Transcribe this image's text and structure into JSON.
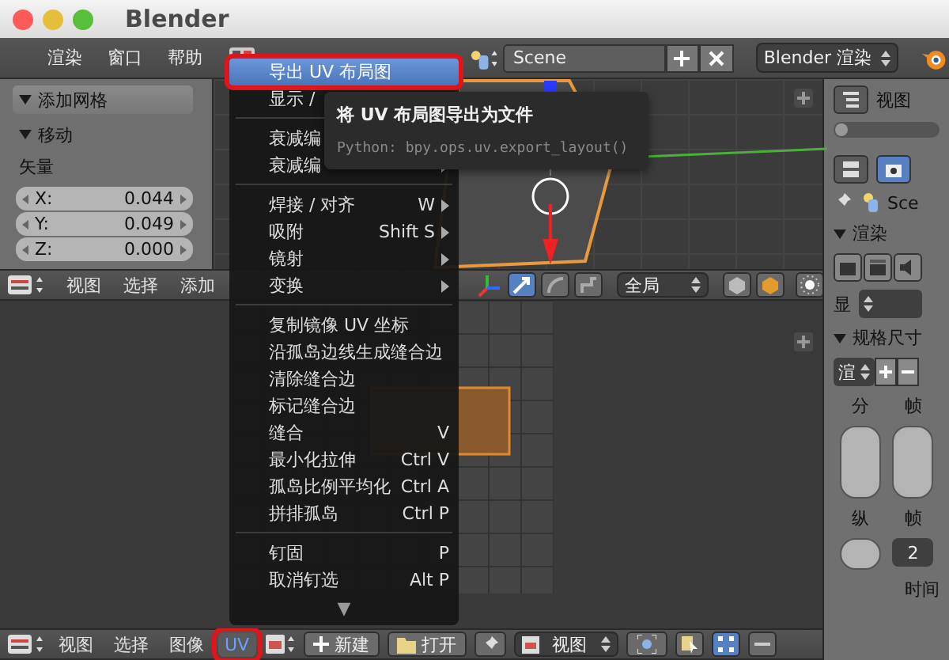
{
  "window": {
    "title": "Blender"
  },
  "top_header": {
    "menus": [
      "渲染",
      "窗口",
      "帮助"
    ],
    "scene": "Scene",
    "engine": "Blender 渲染"
  },
  "tool_shelf": {
    "panel_title": "添加网格",
    "operator": "移动",
    "vector_label": "矢量",
    "fields": [
      {
        "label": "X:",
        "value": "0.044"
      },
      {
        "label": "Y:",
        "value": "0.049"
      },
      {
        "label": "Z:",
        "value": "0.000"
      }
    ]
  },
  "viewport_header": {
    "menus": [
      "视图",
      "选择",
      "添加"
    ],
    "orientation": "全局"
  },
  "uv_header": {
    "menus": [
      {
        "label": "视图",
        "selected": false,
        "annotated": false
      },
      {
        "label": "选择",
        "selected": false,
        "annotated": false
      },
      {
        "label": "图像",
        "selected": false,
        "annotated": false
      },
      {
        "label": "UV",
        "selected": true,
        "annotated": true
      }
    ],
    "new": "新建",
    "open": "打开",
    "view": "视图"
  },
  "uv_menu": {
    "sections": [
      [
        {
          "label": "导出 UV 布局图",
          "submenu": false,
          "selected": true,
          "annotated": true
        },
        {
          "label": "显示 /",
          "submenu": false,
          "selected": false,
          "annotated": false
        }
      ],
      [
        {
          "label": "衰减编",
          "submenu": false,
          "selected": false,
          "annotated": false
        },
        {
          "label": "衰减编",
          "submenu": true,
          "selected": false,
          "annotated": false
        }
      ],
      [
        {
          "label": "焊接 / 对齐",
          "shortcut": "W",
          "submenu": true,
          "selected": false,
          "annotated": false
        },
        {
          "label": "吸附",
          "shortcut": "Shift S",
          "submenu": true,
          "selected": false,
          "annotated": false
        },
        {
          "label": "镜射",
          "submenu": true,
          "selected": false,
          "annotated": false
        },
        {
          "label": "变换",
          "submenu": true,
          "selected": false,
          "annotated": false
        }
      ],
      [
        {
          "label": "复制镜像 UV 坐标",
          "submenu": false,
          "selected": false,
          "annotated": false
        },
        {
          "label": "沿孤岛边线生成缝合边",
          "submenu": false,
          "selected": false,
          "annotated": false
        },
        {
          "label": "清除缝合边",
          "submenu": false,
          "selected": false,
          "annotated": false
        },
        {
          "label": "标记缝合边",
          "submenu": false,
          "selected": false,
          "annotated": false
        },
        {
          "label": "缝合",
          "shortcut": "V",
          "submenu": false,
          "selected": false,
          "annotated": false
        },
        {
          "label": "最小化拉伸",
          "shortcut": "Ctrl V",
          "submenu": false,
          "selected": false,
          "annotated": false
        },
        {
          "label": "孤岛比例平均化",
          "shortcut": "Ctrl A",
          "submenu": false,
          "selected": false,
          "annotated": false
        },
        {
          "label": "拼排孤岛",
          "shortcut": "Ctrl P",
          "submenu": false,
          "selected": false,
          "annotated": false
        }
      ],
      [
        {
          "label": "钉固",
          "shortcut": "P",
          "submenu": false,
          "selected": false,
          "annotated": false
        },
        {
          "label": "取消钉选",
          "shortcut": "Alt P",
          "submenu": false,
          "selected": false,
          "annotated": false
        }
      ]
    ],
    "more": "▼"
  },
  "tooltip": {
    "title": "将 UV 布局图导出为文件",
    "python": "Python: bpy.ops.uv.export_layout()"
  },
  "properties": {
    "view_label": "视图",
    "scene": "Sce",
    "render_panel": "渲染",
    "display_label": "显",
    "dimensions_panel": "规格尺寸",
    "preset": "渲",
    "column_labels": [
      "分",
      "帧"
    ],
    "lower_labels": [
      "纵",
      "帧"
    ],
    "frame_value": "2",
    "time_label": "时间"
  }
}
